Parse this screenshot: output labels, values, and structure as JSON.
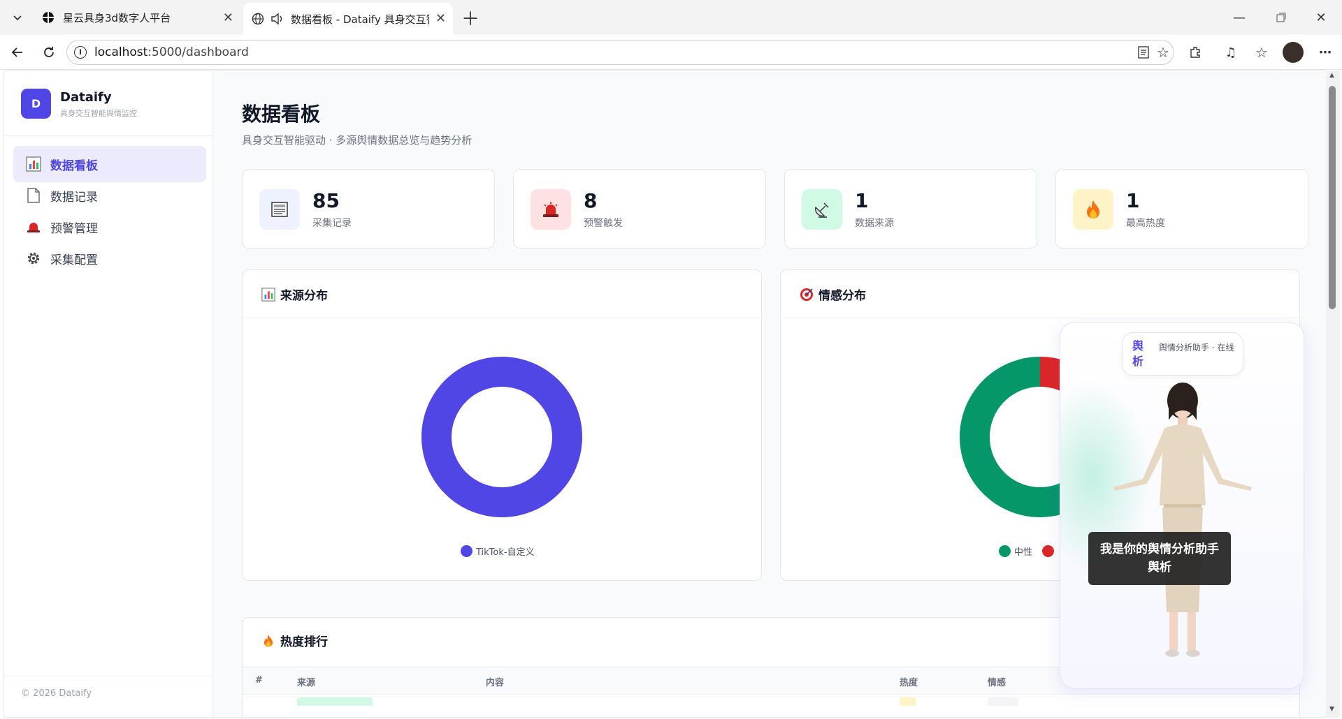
{
  "browser": {
    "tabs": [
      {
        "title": "星云具身3d数字人平台"
      },
      {
        "title": "数据看板 - Dataify 具身交互智"
      }
    ],
    "url_host": "localhost",
    "url_path": ":5000/dashboard"
  },
  "sidebar": {
    "logo_letter": "D",
    "brand": "Dataify",
    "tagline": "具身交互智能舆情监控",
    "items": [
      {
        "label": "数据看板",
        "icon": "bar-chart-icon",
        "active": true
      },
      {
        "label": "数据记录",
        "icon": "document-icon",
        "active": false
      },
      {
        "label": "预警管理",
        "icon": "siren-icon",
        "active": false
      },
      {
        "label": "采集配置",
        "icon": "gear-icon",
        "active": false
      }
    ],
    "footer": "© 2026 Dataify"
  },
  "page": {
    "title": "数据看板",
    "subtitle": "具身交互智能驱动 · 多源舆情数据总览与趋势分析"
  },
  "stats": [
    {
      "value": "85",
      "label": "采集记录",
      "icon": "newspaper-icon",
      "bg": "#eef2ff"
    },
    {
      "value": "8",
      "label": "预警触发",
      "icon": "siren-icon",
      "bg": "#fee2e2"
    },
    {
      "value": "1",
      "label": "数据来源",
      "icon": "satellite-icon",
      "bg": "#d1fae5"
    },
    {
      "value": "1",
      "label": "最高热度",
      "icon": "fire-icon",
      "bg": "#fef3c7"
    }
  ],
  "source_chart": {
    "title": "来源分布",
    "chart_data": {
      "type": "pie",
      "categories": [
        "TikTok-自定义"
      ],
      "values": [
        85
      ],
      "colors": [
        "#4f46e5"
      ]
    }
  },
  "sentiment_chart": {
    "title": "情感分布",
    "chart_data": {
      "type": "pie",
      "categories": [
        "中性",
        "负面"
      ],
      "values": [
        77,
        8
      ],
      "colors": [
        "#059669",
        "#dc2626"
      ]
    },
    "legend_labels": [
      "中性"
    ]
  },
  "hot_ranking": {
    "title": "热度排行",
    "columns": [
      "#",
      "来源",
      "内容",
      "热度",
      "情感"
    ]
  },
  "assistant": {
    "badge": "舆析",
    "status": "舆情分析助手 · 在线",
    "speech": "我是你的舆情分析助手舆析"
  }
}
